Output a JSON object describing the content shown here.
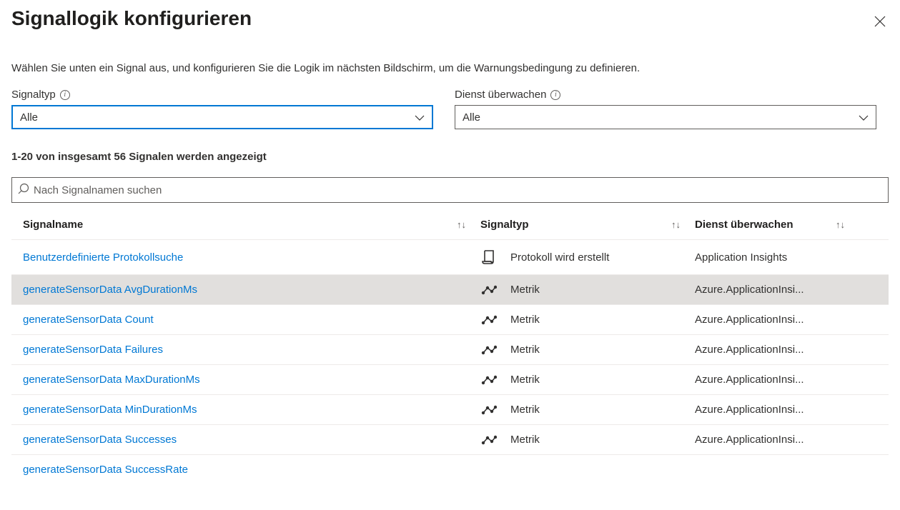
{
  "header": {
    "title": "Signallogik konfigurieren"
  },
  "description": "Wählen Sie unten ein Signal aus, und konfigurieren Sie die Logik im nächsten Bildschirm, um die Warnungsbedingung zu definieren.",
  "filters": {
    "signalType": {
      "label": "Signaltyp",
      "value": "Alle"
    },
    "monitorService": {
      "label": "Dienst überwachen",
      "value": "Alle"
    }
  },
  "resultCount": "1-20 von insgesamt 56 Signalen werden angezeigt",
  "search": {
    "placeholder": "Nach Signalnamen suchen"
  },
  "table": {
    "headers": {
      "name": "Signalname",
      "type": "Signaltyp",
      "service": "Dienst überwachen"
    },
    "rows": [
      {
        "name": "Benutzerdefinierte Protokollsuche",
        "icon": "log",
        "type": "Protokoll wird erstellt",
        "service": "Application Insights",
        "highlighted": false
      },
      {
        "name": "generateSensorData AvgDurationMs",
        "icon": "metric",
        "type": "Metrik",
        "service": "Azure.ApplicationInsi...",
        "highlighted": true
      },
      {
        "name": "generateSensorData Count",
        "icon": "metric",
        "type": "Metrik",
        "service": "Azure.ApplicationInsi...",
        "highlighted": false
      },
      {
        "name": "generateSensorData Failures",
        "icon": "metric",
        "type": "Metrik",
        "service": "Azure.ApplicationInsi...",
        "highlighted": false
      },
      {
        "name": "generateSensorData MaxDurationMs",
        "icon": "metric",
        "type": "Metrik",
        "service": "Azure.ApplicationInsi...",
        "highlighted": false
      },
      {
        "name": "generateSensorData MinDurationMs",
        "icon": "metric",
        "type": "Metrik",
        "service": "Azure.ApplicationInsi...",
        "highlighted": false
      },
      {
        "name": "generateSensorData Successes",
        "icon": "metric",
        "type": "Metrik",
        "service": "Azure.ApplicationInsi...",
        "highlighted": false
      }
    ],
    "partialRow": {
      "name": "generateSensorData SuccessRate"
    }
  }
}
